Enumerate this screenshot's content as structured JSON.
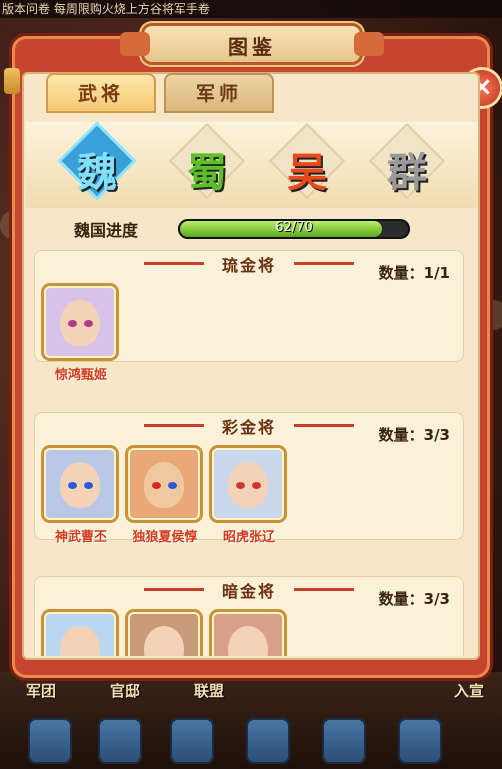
{
  "ticker": "版本问卷 每周限购火烧上方谷将军手卷",
  "panel": {
    "title": "图鉴",
    "close_label": "×"
  },
  "tabs": [
    {
      "label": "武将",
      "active": true
    },
    {
      "label": "军师",
      "active": false
    }
  ],
  "factions": [
    {
      "label": "魏",
      "selected": true,
      "color": "#7fe0ff"
    },
    {
      "label": "蜀",
      "selected": false,
      "color": "#5bbf2a"
    },
    {
      "label": "吴",
      "selected": false,
      "color": "#e84a1c"
    },
    {
      "label": "群",
      "selected": false,
      "color": "#9a9a9a"
    }
  ],
  "progress": {
    "label": "魏国进度",
    "text": "62/70",
    "current": 62,
    "total": 70
  },
  "sections": [
    {
      "title": "琉金将",
      "count_label": "数量：",
      "count": "1/1",
      "heroes": [
        {
          "name": "惊鸿甄姬",
          "icon": "zhenji-portrait",
          "bg": "#d7c3e8"
        }
      ]
    },
    {
      "title": "彩金将",
      "count_label": "数量：",
      "count": "3/3",
      "heroes": [
        {
          "name": "神武曹丕",
          "icon": "caopi-portrait",
          "bg": "#b8c8e6"
        },
        {
          "name": "独狼夏侯惇",
          "icon": "xiahoudun-portrait",
          "bg": "#e8a878"
        },
        {
          "name": "昭虎张辽",
          "icon": "zhangliao-portrait",
          "bg": "#c8d8ea"
        }
      ]
    },
    {
      "title": "暗金将",
      "count_label": "数量：",
      "count": "3/3",
      "heroes": [
        {
          "name": "",
          "icon": "hero-portrait",
          "bg": "#b8d8f0"
        },
        {
          "name": "",
          "icon": "hero-portrait",
          "bg": "#c89a78"
        },
        {
          "name": "",
          "icon": "hero-portrait",
          "bg": "#d8a088"
        }
      ]
    }
  ],
  "bottom_menu": [
    "军团",
    "官邸",
    "联盟",
    "入宣"
  ]
}
